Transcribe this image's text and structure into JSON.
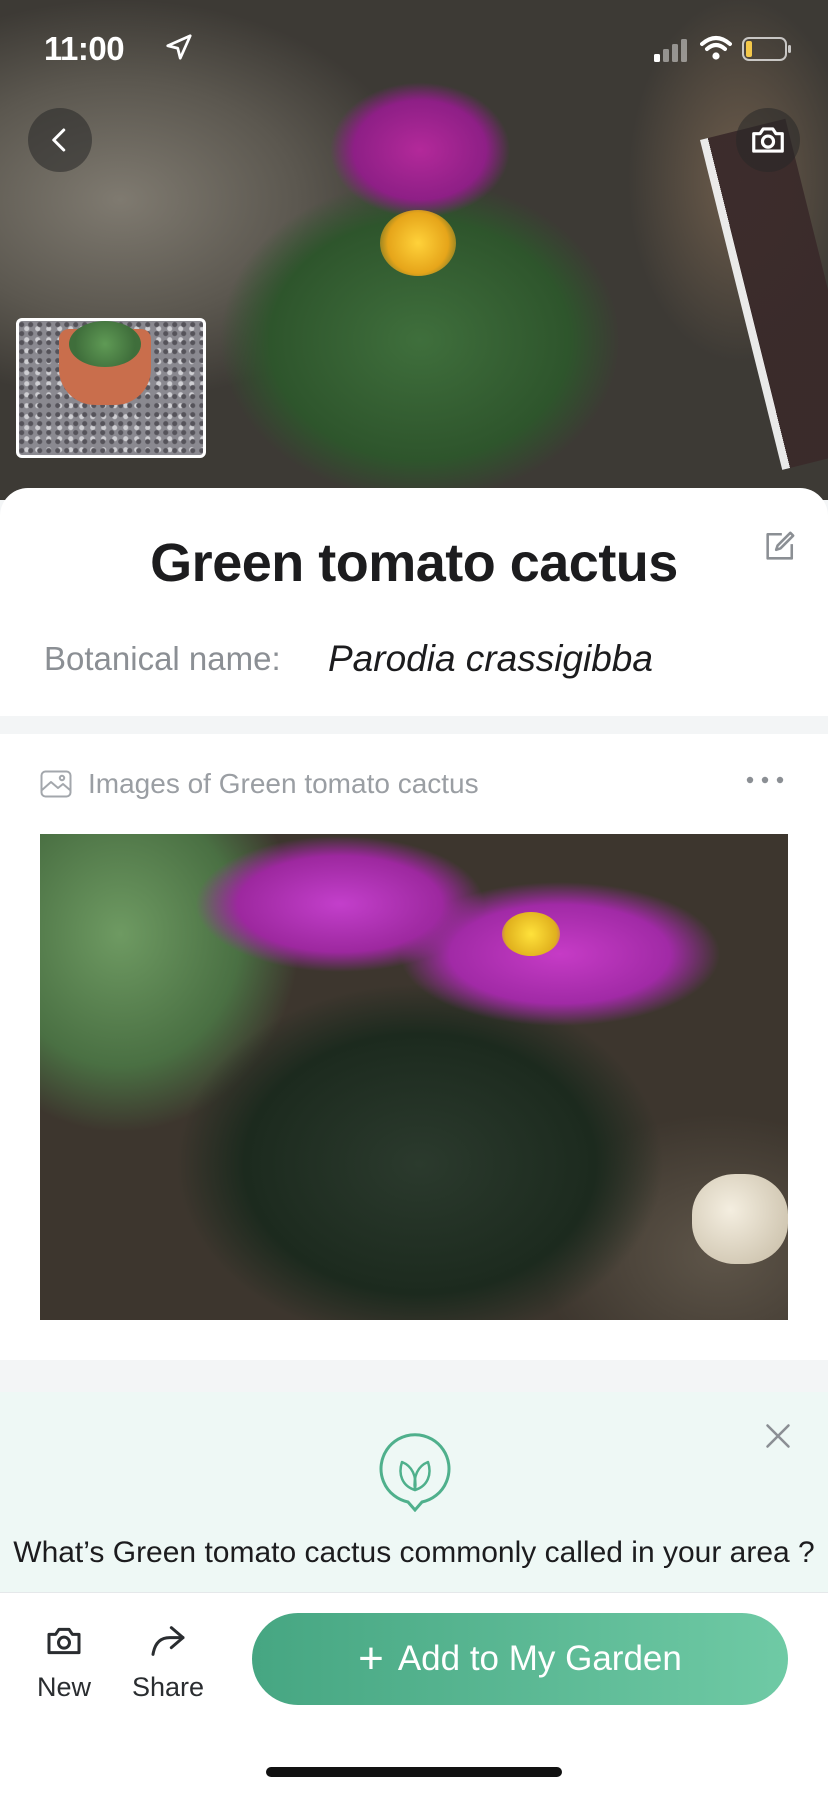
{
  "status": {
    "time": "11:00"
  },
  "plant": {
    "title": "Green tomato cactus",
    "botanical_label": "Botanical name:",
    "botanical_value": "Parodia crassigibba"
  },
  "images": {
    "label": "Images of Green tomato cactus"
  },
  "common_name": {
    "question": "What’s Green tomato cactus commonly called in your area ?"
  },
  "bottom": {
    "new_label": "New",
    "share_label": "Share",
    "add_label": "Add to My Garden",
    "add_plus": "+"
  },
  "colors": {
    "accent": "#4fb08c",
    "accent_light": "#6fcaa5",
    "text": "#1c1c1e",
    "muted": "#8b8f94",
    "card_bg_tint": "#eef8f5"
  },
  "icons": [
    "location-arrow-icon",
    "signal-icon",
    "wifi-icon",
    "battery-icon",
    "back-icon",
    "camera-icon",
    "edit-icon",
    "image-icon",
    "more-icon",
    "close-icon",
    "leaf-icon",
    "share-icon"
  ]
}
